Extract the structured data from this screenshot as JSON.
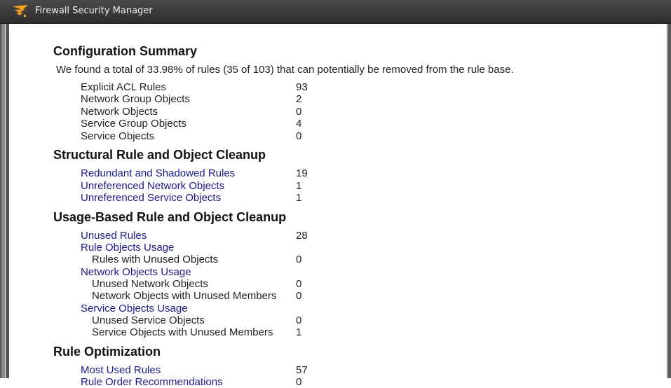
{
  "window": {
    "title": "Firewall Security Manager",
    "logo_icon": "solarwinds-flare-icon"
  },
  "report": {
    "config_summary": {
      "heading": "Configuration Summary",
      "summary_text": "We found a total of 33.98% of rules (35 of 103) that can potentially be removed from the rule base.",
      "rows": [
        {
          "label": "Explicit ACL Rules",
          "value": "93"
        },
        {
          "label": "Network Group Objects",
          "value": "2"
        },
        {
          "label": "Network Objects",
          "value": "0"
        },
        {
          "label": "Service Group Objects",
          "value": "4"
        },
        {
          "label": "Service Objects",
          "value": "0"
        }
      ]
    },
    "structural": {
      "heading": "Structural Rule and Object Cleanup",
      "rows": [
        {
          "label": "Redundant and Shadowed Rules",
          "value": "19"
        },
        {
          "label": "Unreferenced Network Objects",
          "value": "1"
        },
        {
          "label": "Unreferenced Service Objects",
          "value": "1"
        }
      ]
    },
    "usage": {
      "heading": "Usage-Based Rule and Object Cleanup",
      "rows": [
        {
          "label": "Unused Rules",
          "value": "28"
        },
        {
          "label": "Rule Objects Usage",
          "value": ""
        },
        {
          "label": "Rules with Unused Objects",
          "value": "0"
        },
        {
          "label": "Network Objects Usage",
          "value": ""
        },
        {
          "label": "Unused Network Objects",
          "value": "0"
        },
        {
          "label": "Network Objects with Unused Members",
          "value": "0"
        },
        {
          "label": "Service Objects Usage",
          "value": ""
        },
        {
          "label": "Unused Service Objects",
          "value": "0"
        },
        {
          "label": "Service Objects with Unused Members",
          "value": "1"
        }
      ]
    },
    "optimization": {
      "heading": "Rule Optimization",
      "rows": [
        {
          "label": "Most Used Rules",
          "value": "57"
        },
        {
          "label": "Rule Order Recommendations",
          "value": "0"
        }
      ]
    }
  }
}
